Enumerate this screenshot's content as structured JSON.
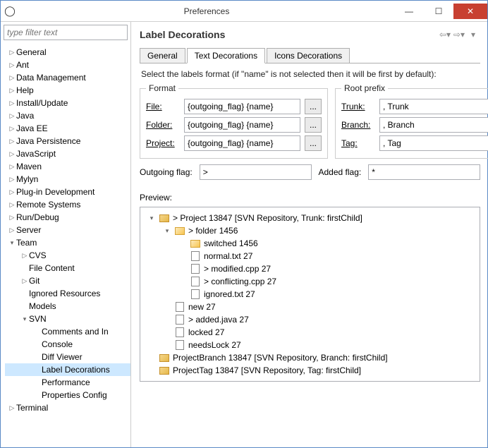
{
  "window": {
    "title": "Preferences"
  },
  "filter": {
    "placeholder": "type filter text"
  },
  "tree": {
    "items": [
      {
        "d": 0,
        "t": ">",
        "l": "General"
      },
      {
        "d": 0,
        "t": ">",
        "l": "Ant"
      },
      {
        "d": 0,
        "t": ">",
        "l": "Data Management"
      },
      {
        "d": 0,
        "t": ">",
        "l": "Help"
      },
      {
        "d": 0,
        "t": ">",
        "l": "Install/Update"
      },
      {
        "d": 0,
        "t": ">",
        "l": "Java"
      },
      {
        "d": 0,
        "t": ">",
        "l": "Java EE"
      },
      {
        "d": 0,
        "t": ">",
        "l": "Java Persistence"
      },
      {
        "d": 0,
        "t": ">",
        "l": "JavaScript"
      },
      {
        "d": 0,
        "t": ">",
        "l": "Maven"
      },
      {
        "d": 0,
        "t": ">",
        "l": "Mylyn"
      },
      {
        "d": 0,
        "t": ">",
        "l": "Plug-in Development"
      },
      {
        "d": 0,
        "t": ">",
        "l": "Remote Systems"
      },
      {
        "d": 0,
        "t": ">",
        "l": "Run/Debug"
      },
      {
        "d": 0,
        "t": ">",
        "l": "Server"
      },
      {
        "d": 0,
        "t": "v",
        "l": "Team"
      },
      {
        "d": 1,
        "t": ">",
        "l": "CVS"
      },
      {
        "d": 1,
        "t": " ",
        "l": "File Content"
      },
      {
        "d": 1,
        "t": ">",
        "l": "Git"
      },
      {
        "d": 1,
        "t": " ",
        "l": "Ignored Resources"
      },
      {
        "d": 1,
        "t": " ",
        "l": "Models"
      },
      {
        "d": 1,
        "t": "v",
        "l": "SVN"
      },
      {
        "d": 2,
        "t": " ",
        "l": "Comments and In"
      },
      {
        "d": 2,
        "t": " ",
        "l": "Console"
      },
      {
        "d": 2,
        "t": " ",
        "l": "Diff Viewer"
      },
      {
        "d": 2,
        "t": " ",
        "l": "Label Decorations",
        "sel": true
      },
      {
        "d": 2,
        "t": " ",
        "l": "Performance"
      },
      {
        "d": 2,
        "t": " ",
        "l": "Properties Config"
      },
      {
        "d": 0,
        "t": ">",
        "l": "Terminal"
      }
    ]
  },
  "page": {
    "title": "Label Decorations",
    "tabs": [
      "General",
      "Text Decorations",
      "Icons Decorations"
    ],
    "active_tab": 1,
    "description": "Select the labels format (if \"name\" is not selected then it will be first by default):",
    "format": {
      "legend": "Format",
      "rows": [
        {
          "label": "File:",
          "ul": "F",
          "value": "{outgoing_flag} {name}"
        },
        {
          "label": "Folder:",
          "ul": "F",
          "value": "{outgoing_flag} {name}"
        },
        {
          "label": "Project:",
          "ul": "P",
          "value": "{outgoing_flag} {name}"
        }
      ]
    },
    "rootprefix": {
      "legend": "Root prefix",
      "rows": [
        {
          "label": "Trunk:",
          "value": ", Trunk"
        },
        {
          "label": "Branch:",
          "value": ", Branch"
        },
        {
          "label": "Tag:",
          "value": ", Tag"
        }
      ]
    },
    "outgoing": {
      "label": "Outgoing flag:",
      "value": ">"
    },
    "added": {
      "label": "Added flag:",
      "value": "*"
    },
    "preview_label": "Preview:",
    "preview": [
      {
        "d": 0,
        "t": "v",
        "i": "pj",
        "l": "> Project 13847 [SVN Repository, Trunk: firstChild]"
      },
      {
        "d": 1,
        "t": "v",
        "i": "fd",
        "l": "> folder 1456"
      },
      {
        "d": 2,
        "t": " ",
        "i": "fd",
        "l": "switched 1456"
      },
      {
        "d": 2,
        "t": " ",
        "i": "fl",
        "l": "normal.txt 27"
      },
      {
        "d": 2,
        "t": " ",
        "i": "fl",
        "l": "> modified.cpp 27"
      },
      {
        "d": 2,
        "t": " ",
        "i": "fl",
        "l": "> conflicting.cpp 27"
      },
      {
        "d": 2,
        "t": " ",
        "i": "fl",
        "l": "ignored.txt 27"
      },
      {
        "d": 1,
        "t": " ",
        "i": "fl",
        "l": "new 27"
      },
      {
        "d": 1,
        "t": " ",
        "i": "fl",
        "l": "> added.java 27"
      },
      {
        "d": 1,
        "t": " ",
        "i": "fl",
        "l": "locked 27"
      },
      {
        "d": 1,
        "t": " ",
        "i": "fl",
        "l": "needsLock 27"
      },
      {
        "d": 0,
        "t": " ",
        "i": "pj",
        "l": "ProjectBranch 13847 [SVN Repository, Branch: firstChild]"
      },
      {
        "d": 0,
        "t": " ",
        "i": "pj",
        "l": "ProjectTag 13847 [SVN Repository, Tag: firstChild]"
      }
    ]
  }
}
